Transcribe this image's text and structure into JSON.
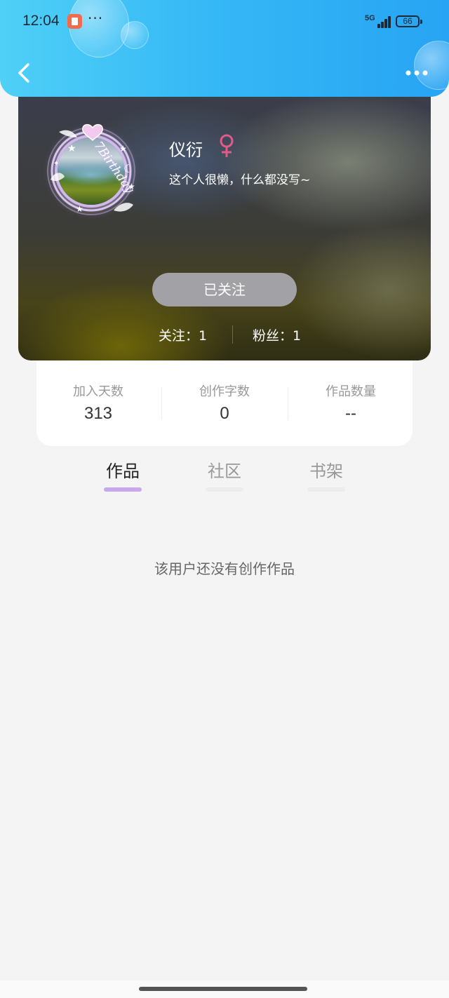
{
  "status_bar": {
    "time": "12:04",
    "overflow": "···",
    "network": "5G",
    "battery": "66"
  },
  "nav": {
    "back_icon": "chevron-left-icon",
    "more_icon": "more-dots-icon"
  },
  "profile": {
    "avatar_caption": "7Birthday",
    "name": "仪衍",
    "gender_symbol": "♀",
    "bio": "这个人很懒，什么都没写~",
    "follow_button_label": "已关注",
    "following_text": "关注：1",
    "fans_text": "粉丝：1"
  },
  "counters": [
    {
      "label": "加入天数",
      "value": "313"
    },
    {
      "label": "创作字数",
      "value": "0"
    },
    {
      "label": "作品数量",
      "value": "--"
    }
  ],
  "tabs": [
    {
      "label": "作品",
      "active": true
    },
    {
      "label": "社区",
      "active": false
    },
    {
      "label": "书架",
      "active": false
    }
  ],
  "empty_message": "该用户还没有创作作品",
  "colors": {
    "header_gradient_start": "#4fd0f7",
    "header_gradient_end": "#27a4f3",
    "active_tab_indicator": "#c7a8ea",
    "gender_icon": "#e05a8a",
    "follow_button_bg": "#a2a1a6"
  }
}
